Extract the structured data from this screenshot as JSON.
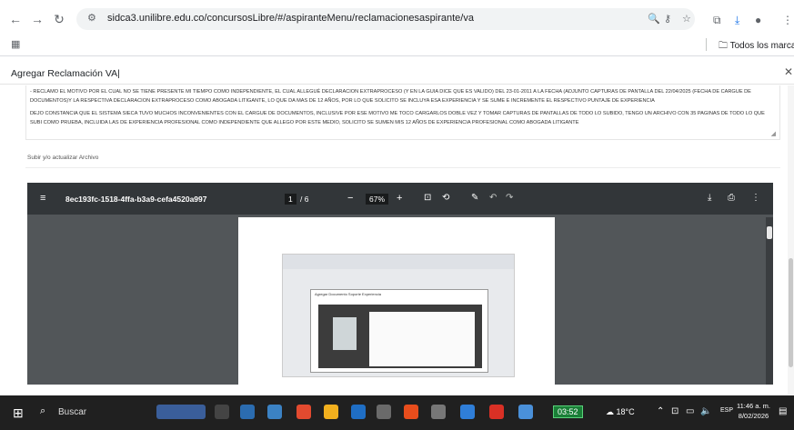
{
  "browser": {
    "url": "sidca3.unilibre.edu.co/concursosLibre/#/aspiranteMenu/reclamacionesaspirante/va",
    "bookmarks_label": "Todos los marcadores"
  },
  "modal": {
    "title": "Agregar Reclamación VA|",
    "paragraph_1": "- RECLAMO EL MOTIVO POR EL CUAL NO SE TIENE PRESENTE MI TIEMPO COMO INDEPENDIENTE, EL CUAL ALLEGUÉ DECLARACION EXTRAPROCESO (Y EN LA GUIA DICE QUE ES VALIDO) DEL 23-01-2011 A LA FECHA (ADJUNTO CAPTURAS DE PANTALLA DEL 22/04/2025 (FECHA DE CARGUE DE DOCUMENTOS)Y LA RESPECTIVA DECLARACION EXTRAPROCESO COMO ABOGADA LITIGANTE, LO QUE DA MAS DE 12 AÑOS, POR LO QUE SOLICITO SE INCLUYA ESA EXPERIENCIA Y SE SUME E INCREMENTE EL RESPECTIVO PUNTAJE DE EXPERIENCIA",
    "paragraph_2": "DEJO CONSTANCIA QUE EL SISTEMA SIECA TUVO MUCHOS INCONVENIENTES CON EL CARGUE DE DOCUMENTOS, INCLUSIVE POR ESE MOTIVO ME TOCO CARGARLOS DOBLE VEZ Y TOMAR CAPTURAS DE PANTALLAS DE TODO LO SUBIDO, TENGO UN ARCHIVO CON 35 PAGINAS DE TODO LO QUE SUBI COMO PRUEBA, INCLUIDA LAS DE EXPERIENCIA PROFESIONAL COMO INDEPENDIENTE QUE ALLEGO POR ESTE MEDIO, SOLICITO SE SUMEN MIS 12 AÑOS DE EXPERIENCIA PROFESIONAL COMO ABOGADA LITIGANTE",
    "upload_label": "Subir y/o actualizar Archivo"
  },
  "pdf_viewer": {
    "filename": "8ec193fc-1518-4ffa-b3a9-cefa4520a997",
    "page_current": "1",
    "page_total": "/ 6",
    "zoom": "67%",
    "inner_modal_title": "Agregar Documento Soporte Experiencia"
  },
  "taskbar": {
    "search_label": "Buscar",
    "pill_time": "03:52",
    "weather": "18°C",
    "lang": "ESP",
    "time": "11:46 a. m.",
    "date": "8/02/2026"
  }
}
